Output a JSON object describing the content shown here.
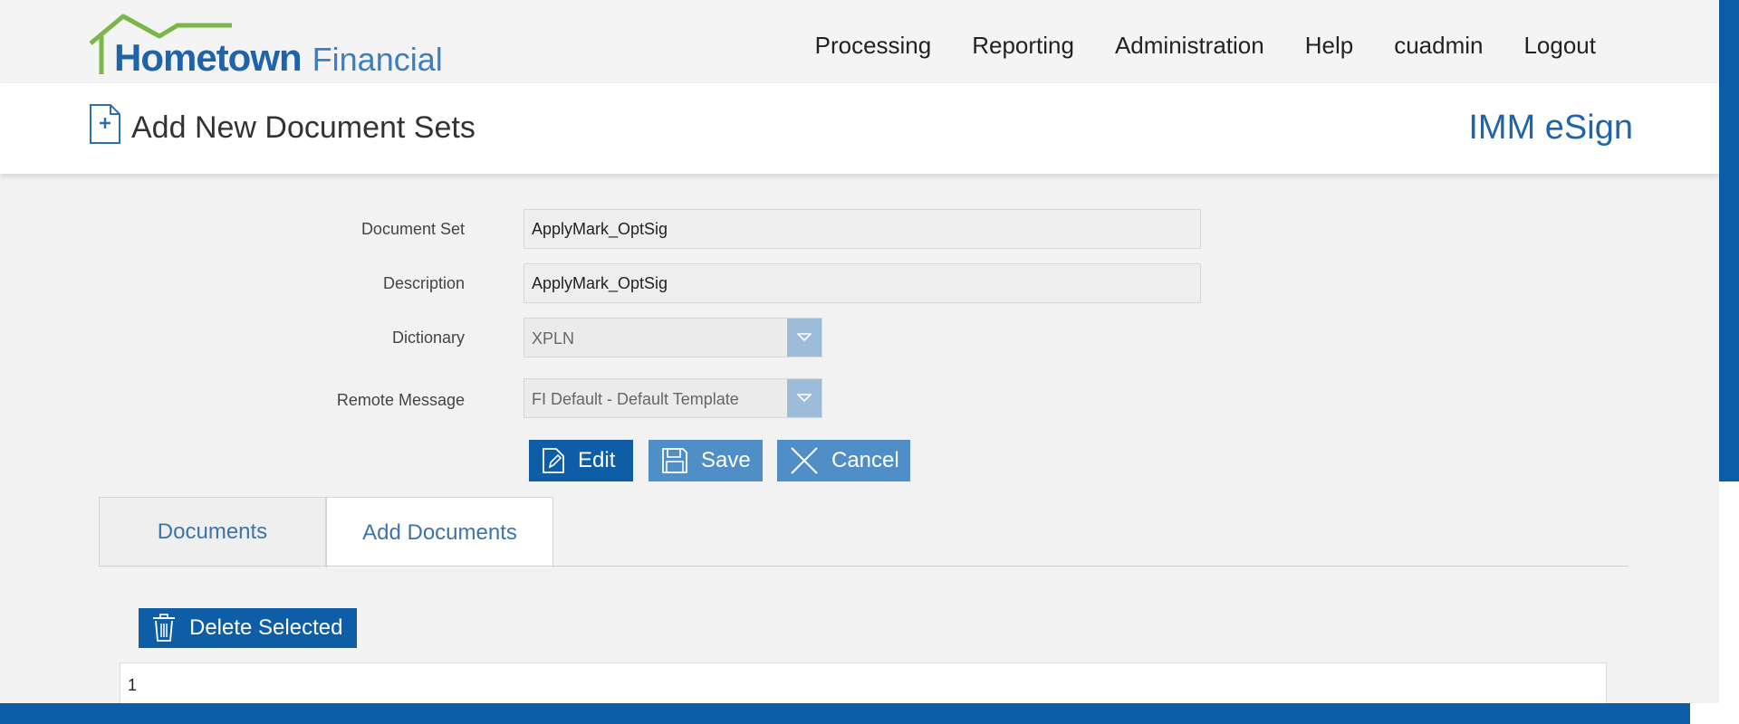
{
  "header": {
    "logo_word1": "Hometown",
    "logo_word2": "Financial",
    "nav": [
      "Processing",
      "Reporting",
      "Administration",
      "Help",
      "cuadmin",
      "Logout"
    ]
  },
  "titlebar": {
    "title": "Add New Document Sets",
    "brand": "IMM eSign",
    "icon": "new-document-icon"
  },
  "form": {
    "document_set": {
      "label": "Document Set",
      "value": "ApplyMark_OptSig"
    },
    "description": {
      "label": "Description",
      "value": "ApplyMark_OptSig"
    },
    "dictionary": {
      "label": "Dictionary",
      "value": "XPLN"
    },
    "remote_message": {
      "label": "Remote Message",
      "value": "FI Default - Default Template"
    }
  },
  "actions": {
    "edit": "Edit",
    "save": "Save",
    "cancel": "Cancel"
  },
  "tabs": [
    "Documents",
    "Add Documents"
  ],
  "documents": {
    "delete_selected": "Delete Selected",
    "items": [
      "1"
    ]
  },
  "colors": {
    "primary": "#0d5ea6",
    "secondary": "#4f8ec7",
    "logo_green": "#7ab648",
    "brand_text": "#1f63a8"
  }
}
